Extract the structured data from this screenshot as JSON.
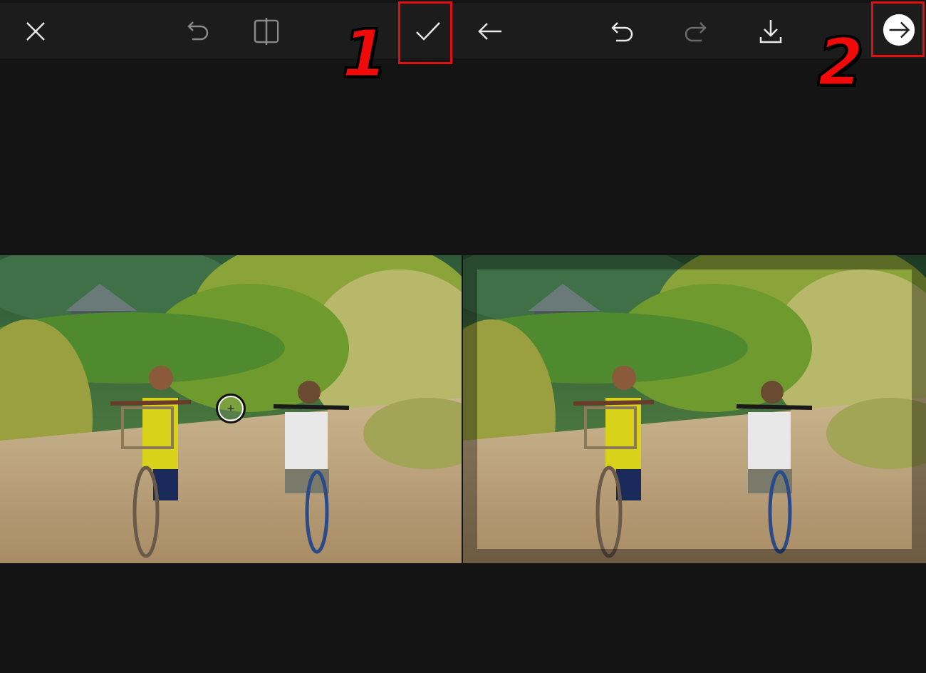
{
  "left_panel": {
    "toolbar": {
      "close_icon": "close-icon",
      "undo_icon": "undo-icon",
      "compare_icon": "compare-split-icon",
      "apply_icon": "checkmark-icon"
    },
    "step_label": "1",
    "cursor_symbol": "+"
  },
  "right_panel": {
    "toolbar": {
      "back_icon": "back-arrow-icon",
      "undo_icon": "undo-icon",
      "redo_icon": "redo-icon",
      "download_icon": "download-icon",
      "next_icon": "next-arrow-circle-icon"
    },
    "step_label": "2"
  },
  "colors": {
    "toolbar_bg": "#1c1c1c",
    "canvas_bg": "#141414",
    "highlight": "#e01010",
    "icon_active": "#ffffff",
    "icon_disabled": "#8a8a8a"
  }
}
